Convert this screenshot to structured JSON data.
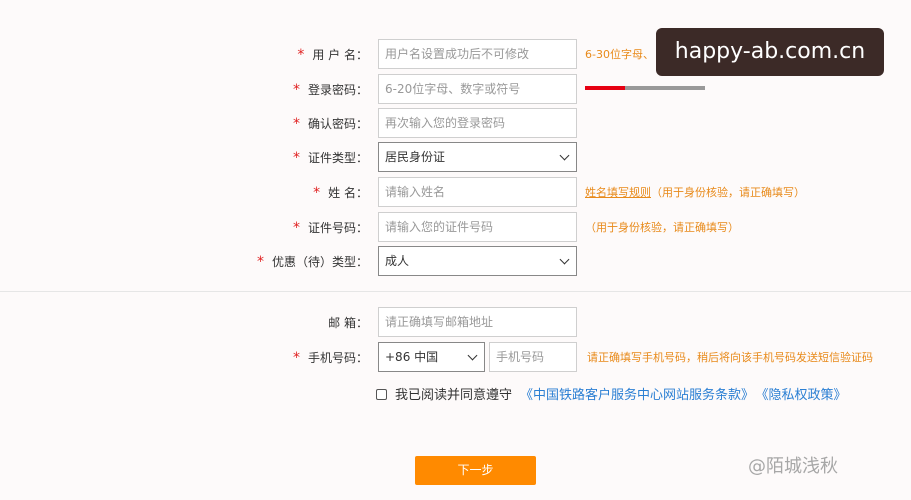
{
  "form": {
    "username": {
      "star": "*",
      "label": "用 户 名：",
      "placeholder": "用户名设置成功后不可修改",
      "hint": "6-30位字母、"
    },
    "password": {
      "star": "*",
      "label": "登录密码：",
      "placeholder": "6-20位字母、数字或符号"
    },
    "confirm": {
      "star": "*",
      "label": "确认密码：",
      "placeholder": "再次输入您的登录密码"
    },
    "id_type": {
      "star": "*",
      "label": "证件类型：",
      "value": "居民身份证"
    },
    "name": {
      "star": "*",
      "label": "姓 名：",
      "placeholder": "请输入姓名",
      "hint_link": "姓名填写规则",
      "hint": "（用于身份核验，请正确填写）"
    },
    "id_number": {
      "star": "*",
      "label": "证件号码：",
      "placeholder": "请输入您的证件号码",
      "hint": "（用于身份核验，请正确填写）"
    },
    "discount": {
      "star": "*",
      "label": "优惠（待）类型：",
      "value": "成人"
    },
    "email": {
      "label": "邮 箱：",
      "placeholder": "请正确填写邮箱地址"
    },
    "phone": {
      "star": "*",
      "label": "手机号码：",
      "code": "+86 中国",
      "placeholder": "手机号码",
      "hint": "请正确填写手机号码，稍后将向该手机号码发送短信验证码"
    },
    "agree": {
      "text": "我已阅读并同意遵守",
      "link1": "《中国铁路客户服务中心网站服务条款》",
      "link2": "《隐私权政策》"
    },
    "next_label": "下一步"
  },
  "password_strength": {
    "level": 1,
    "max": 3,
    "colors": {
      "active": "#e60012",
      "inactive": "#999999"
    }
  },
  "overlay": {
    "banner": "happy-ab.com.cn",
    "watermark": "@陌城浅秋"
  }
}
